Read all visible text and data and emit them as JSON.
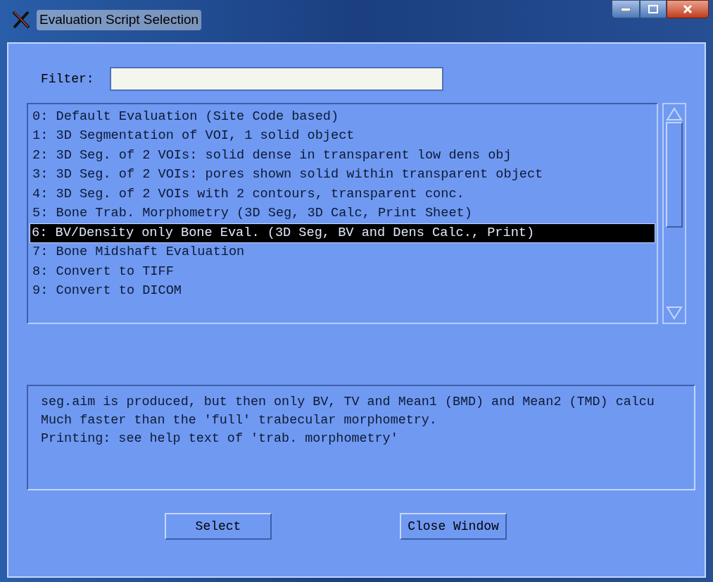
{
  "window": {
    "title": "Evaluation Script Selection"
  },
  "filter": {
    "label": "Filter:"
  },
  "scripts": [
    {
      "label": "0: Default Evaluation (Site Code based)",
      "selected": false
    },
    {
      "label": "1: 3D Segmentation of VOI, 1 solid object",
      "selected": false
    },
    {
      "label": "2: 3D Seg. of 2 VOIs: solid dense in transparent low dens obj",
      "selected": false
    },
    {
      "label": "3: 3D Seg. of 2 VOIs: pores shown solid within transparent object",
      "selected": false
    },
    {
      "label": "4: 3D Seg. of 2 VOIs with 2 contours, transparent conc.",
      "selected": false
    },
    {
      "label": "5: Bone Trab. Morphometry (3D Seg, 3D Calc, Print Sheet)",
      "selected": false
    },
    {
      "label": "6: BV/Density only Bone Eval. (3D Seg, BV and Dens Calc., Print)",
      "selected": true
    },
    {
      "label": "7: Bone Midshaft Evaluation",
      "selected": false
    },
    {
      "label": "8: Convert to TIFF",
      "selected": false
    },
    {
      "label": "9: Convert to DICOM",
      "selected": false
    }
  ],
  "description": [
    "seg.aim is produced, but then only BV, TV and Mean1 (BMD) and Mean2 (TMD) calcu",
    "Much faster than the 'full' trabecular morphometry.",
    "Printing: see help text of 'trab. morphometry'"
  ],
  "buttons": [
    "Select",
    "Close Window"
  ]
}
